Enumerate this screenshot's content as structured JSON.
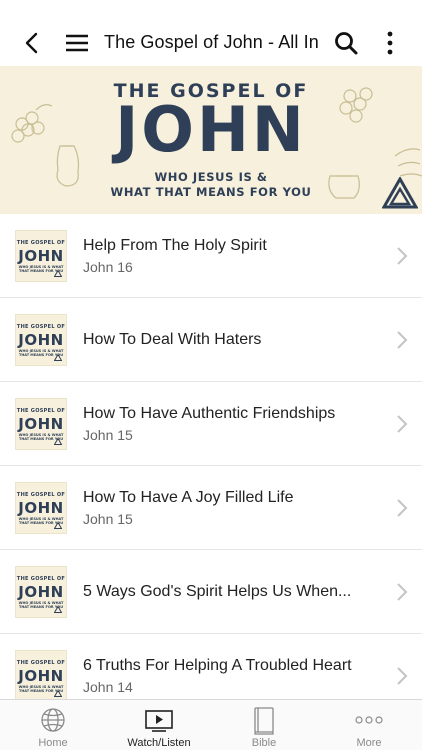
{
  "header": {
    "title": "The Gospel of John - All In"
  },
  "banner": {
    "top_text": "THE GOSPEL OF",
    "big_text": "JOHN",
    "sub_line1": "WHO JESUS IS &",
    "sub_line2": "WHAT THAT MEANS FOR YOU"
  },
  "thumbnail": {
    "top": "THE GOSPEL OF",
    "big": "JOHN",
    "sub": "WHO JESUS IS & WHAT THAT MEANS FOR YOU"
  },
  "items": [
    {
      "title": "Help From The Holy Spirit",
      "subtitle": "John 16"
    },
    {
      "title": "How To Deal With Haters",
      "subtitle": ""
    },
    {
      "title": "How To Have Authentic Friendships",
      "subtitle": "John 15"
    },
    {
      "title": "How To Have A Joy Filled Life",
      "subtitle": "John 15"
    },
    {
      "title": "5 Ways God's Spirit Helps Us When...",
      "subtitle": ""
    },
    {
      "title": "6 Truths For Helping A Troubled Heart",
      "subtitle": "John 14"
    }
  ],
  "tabs": [
    {
      "label": "Home",
      "icon": "globe-icon",
      "active": false
    },
    {
      "label": "Watch/Listen",
      "icon": "play-icon",
      "active": true
    },
    {
      "label": "Bible",
      "icon": "book-icon",
      "active": false
    },
    {
      "label": "More",
      "icon": "more-icon",
      "active": false
    }
  ],
  "colors": {
    "banner_bg": "#f6f0dc",
    "banner_text": "#2e3f57",
    "tab_active": "#222222",
    "tab_inactive": "#8a8a8a"
  }
}
